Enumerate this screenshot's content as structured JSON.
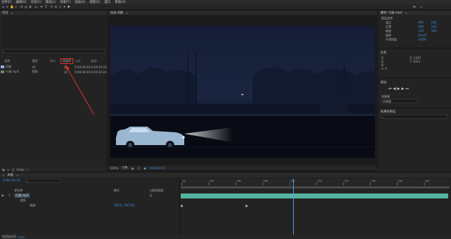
{
  "app": {
    "menu": [
      "文件(F)",
      "编辑(E)",
      "合成(C)",
      "图层(L)",
      "效果(T)",
      "动画(A)",
      "视图(V)",
      "窗口",
      "帮助(H)"
    ]
  },
  "project": {
    "tab_label": "项目",
    "search_placeholder": "",
    "columns": [
      "名称",
      "类型",
      "大小",
      "帧速率",
      "入点",
      "出点"
    ],
    "items": [
      {
        "name": "风格",
        "type": "AE",
        "size": "",
        "fps": "25",
        "in": "0:00:00:00",
        "out": "0:00:19:24"
      },
      {
        "name": "行驶.mp4",
        "type": "视频",
        "size": "",
        "fps": "25",
        "in": "0:00:00:00",
        "out": "0:00:19:24"
      }
    ],
    "footer_bpc": "8 bpc"
  },
  "composition": {
    "tab_label": "合成 风格",
    "zoom": "100%",
    "quality": "完整",
    "timecode": "0:00:03:21"
  },
  "properties": {
    "tab_label": "属性: 行驶.mp4",
    "section": "图层变换",
    "rows": [
      {
        "label": "锚点",
        "v1": "960",
        "v2": "540"
      },
      {
        "label": "位置",
        "v1": "960",
        "v2": "540"
      },
      {
        "label": "缩放",
        "v1": "100",
        "v2": "100"
      },
      {
        "label": "旋转",
        "v1": "0x+0°",
        "v2": ""
      },
      {
        "label": "不透明度",
        "v1": "100%",
        "v2": ""
      }
    ],
    "info_title": "信息",
    "info_lines": [
      "R:",
      "G:",
      "B:",
      "A: 0"
    ],
    "info_xy": [
      "X: 1397",
      "Y: 1021"
    ],
    "preview_title": "预览",
    "preview_shortcut": "快捷键",
    "preview_shortcut_value": "空格键",
    "effects_title": "效果和预设",
    "effects_search": ""
  },
  "timeline": {
    "tab_label": "风格",
    "timecode": "0:00:03:21",
    "search_placeholder": "",
    "col_source": "源名称",
    "col_mode": "模式",
    "col_parent": "父级和链接",
    "layer_name": "行驶.mp4",
    "layer_num": "1",
    "sub_transform": "变换",
    "sub_prop": "缩放",
    "sub_value": "100.0, 100.0%",
    "parent_value": "无",
    "ruler_labels": [
      "0s",
      "02s",
      "04s",
      "06s",
      "08s",
      "10s",
      "12s",
      "14s",
      "16s",
      "18s"
    ],
    "render_label": "帧渲染时间",
    "render_value": "5ms",
    "keyframes": [
      0.0,
      0.24
    ]
  }
}
